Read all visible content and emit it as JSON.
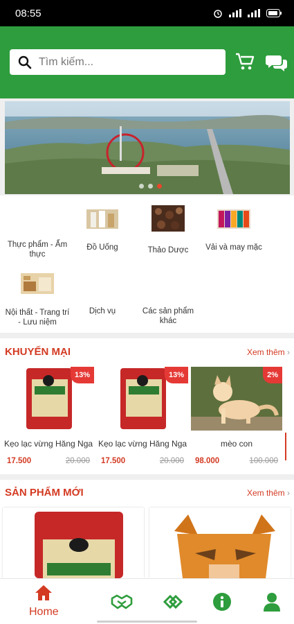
{
  "status_bar": {
    "time": "08:55"
  },
  "search": {
    "placeholder": "Tìm kiếm..."
  },
  "header_icons": [
    "cart-icon",
    "chat-icon"
  ],
  "banner": {
    "slide_count": 3,
    "active_slide": 3
  },
  "categories": [
    {
      "label": "Thực phẩm - Ẩm thực",
      "icon": "food-thumb"
    },
    {
      "label": "Đồ Uống",
      "icon": "drinks-thumb"
    },
    {
      "label": "Thảo Dược",
      "icon": "herbs-thumb"
    },
    {
      "label": "Vải và may mặc",
      "icon": "fabric-thumb"
    },
    {
      "label": "Nội thất - Trang trí - Lưu niệm",
      "icon": "furniture-thumb"
    },
    {
      "label": "Dịch vụ",
      "icon": ""
    },
    {
      "label": "Các sản phẩm khác",
      "icon": ""
    }
  ],
  "promo_section": {
    "title": "KHUYẾN MẠI",
    "more": "Xem thêm",
    "products": [
      {
        "name": "Kẹo lạc vừng Hăng Nga",
        "price": "17.500",
        "old_price": "20.000",
        "discount": "13%"
      },
      {
        "name": "Kẹo lạc vừng Hăng Nga",
        "price": "17.500",
        "old_price": "20.000",
        "discount": "13%"
      },
      {
        "name": "mèo con",
        "price": "98.000",
        "old_price": "100.000",
        "discount": "2%"
      }
    ]
  },
  "new_section": {
    "title": "SẢN PHẨM MỚI",
    "more": "Xem thêm"
  },
  "bottom_nav": {
    "home_label": "Home",
    "items": [
      "home-icon",
      "handshake-icon",
      "partner-icon",
      "info-icon",
      "user-icon"
    ]
  },
  "colors": {
    "primary_green": "#2e9d3d",
    "accent_red": "#d33a22",
    "badge_red": "#e53935"
  }
}
